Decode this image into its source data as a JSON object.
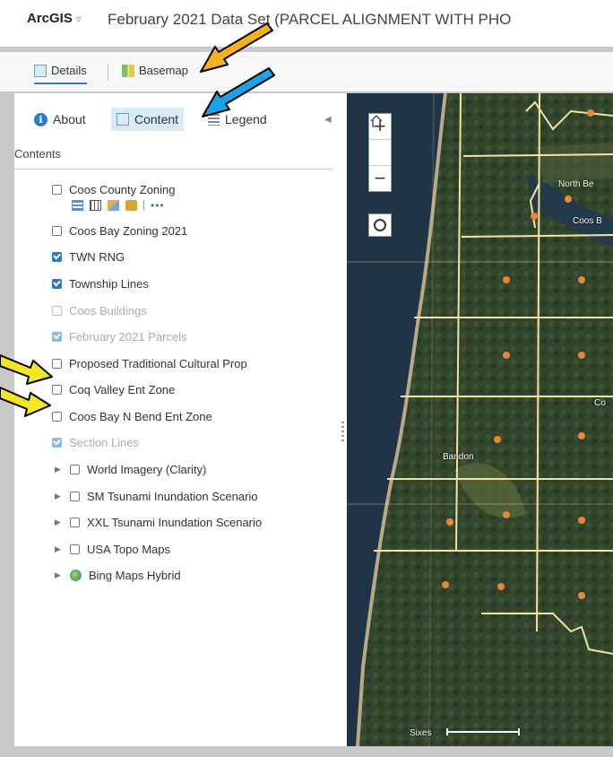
{
  "header": {
    "app_name": "ArcGIS",
    "title": "February 2021 Data Set (PARCEL ALIGNMENT WITH PHO"
  },
  "toptabs": [
    {
      "label": "Details",
      "icon": "details-icon",
      "active": true
    },
    {
      "label": "Basemap",
      "icon": "basemap-grid-icon",
      "active": false
    }
  ],
  "subtabs": [
    {
      "label": "About",
      "icon": "info-icon"
    },
    {
      "label": "Content",
      "icon": "content-icon",
      "active": true
    },
    {
      "label": "Legend",
      "icon": "legend-icon"
    }
  ],
  "contents_label": "Contents",
  "layers": [
    {
      "label": "Coos County Zoning",
      "checked": false,
      "dim": false
    },
    {
      "label": "Coos Bay Zoning 2021",
      "checked": false,
      "dim": false
    },
    {
      "label": "TWN RNG",
      "checked": true,
      "dim": false
    },
    {
      "label": "Township Lines",
      "checked": true,
      "dim": false
    },
    {
      "label": "Coos Buildings",
      "checked": false,
      "dim": true
    },
    {
      "label": "February 2021 Parcels",
      "checked": true,
      "dim": true
    },
    {
      "label": "Proposed Traditional Cultural Prop",
      "checked": false,
      "dim": false
    },
    {
      "label": "Coq Valley Ent Zone",
      "checked": false,
      "dim": false
    },
    {
      "label": "Coos Bay N Bend Ent Zone",
      "checked": false,
      "dim": false
    },
    {
      "label": "Section Lines",
      "checked": true,
      "dim": true
    }
  ],
  "basemap_layers": [
    {
      "label": "World Imagery (Clarity)"
    },
    {
      "label": "SM Tsunami Inundation Scenario"
    },
    {
      "label": "XXL Tsunami Inundation Scenario"
    },
    {
      "label": "USA Topo Maps"
    },
    {
      "label": "Bing Maps Hybrid"
    }
  ],
  "layer_tools": [
    "show-table-icon",
    "attribute-table-icon",
    "change-style-icon",
    "filter-icon",
    "more-options-icon"
  ],
  "map": {
    "labels": [
      "North Be",
      "Coos B",
      "Bandon",
      "Co",
      "Sixes"
    ],
    "zoom_in": "+",
    "zoom_out": "−"
  },
  "colors": {
    "accent": "#2b7cc2",
    "grid_lines": "#f3e4a2",
    "point_markers": "#e8873a",
    "arrow_yellow": "#f5e625",
    "arrow_orange": "#f6b21d",
    "arrow_blue": "#1aa3e8"
  }
}
